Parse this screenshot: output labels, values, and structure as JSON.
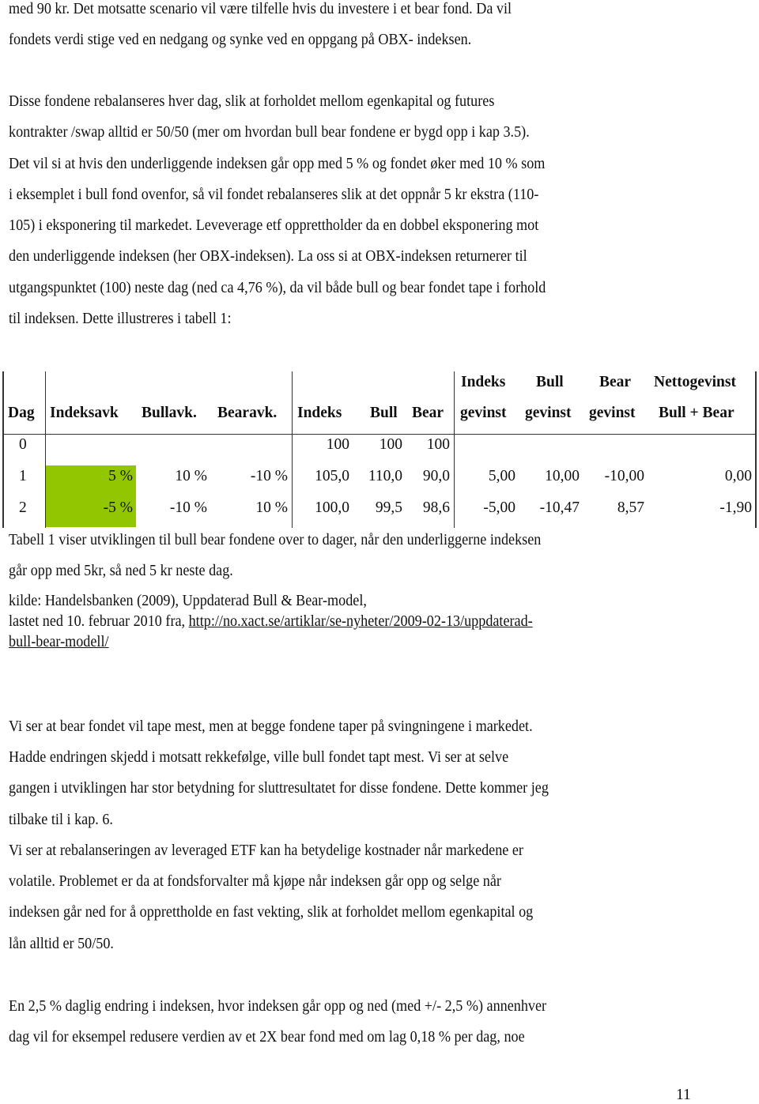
{
  "paragraphs_top": [
    "med 90 kr. Det motsatte scenario vil være tilfelle hvis du investere i et bear fond. Da vil",
    "fondets verdi stige ved en nedgang og synke ved en oppgang på OBX- indeksen.",
    "Disse fondene rebalanseres hver dag, slik at forholdet mellom egenkapital og futures",
    "kontrakter /swap alltid er 50/50 (mer om hvordan bull bear fondene er bygd opp i kap 3.5).",
    "Det vil si at hvis den underliggende indeksen går opp med 5 % og fondet øker med 10 % som",
    "i eksemplet i bull fond ovenfor, så vil fondet rebalanseres slik at det oppnår 5 kr ekstra (110-",
    "105) i eksponering til markedet. Leveverage etf opprettholder da en dobbel eksponering mot",
    "den underliggende indeksen (her OBX-indeksen). La oss si at OBX-indeksen returnerer til",
    "utgangspunktet (100) neste dag (ned ca 4,76 %), da vil både bull og bear fondet tape i forhold",
    "til indeksen. Dette illustreres i tabell 1:"
  ],
  "table": {
    "header_top": [
      "Indeks",
      "Bull",
      "Bear",
      "Nettogevinst"
    ],
    "header": [
      "Dag",
      "Indeksavk",
      "Bullavk.",
      "Bearavk.",
      "Indeks",
      "Bull",
      "Bear",
      "gevinst",
      "gevinst",
      "gevinst",
      "Bull + Bear"
    ],
    "rows": [
      [
        "0",
        "",
        "",
        "",
        "100",
        "100",
        "100",
        "",
        "",
        "",
        ""
      ],
      [
        "1",
        "5 %",
        "10 %",
        "-10 %",
        "105,0",
        "110,0",
        "90,0",
        "5,00",
        "10,00",
        "-10,00",
        "0,00"
      ],
      [
        "2",
        "-5 %",
        "-10 %",
        "10 %",
        "100,0",
        "99,5",
        "98,6",
        "-5,00",
        "-10,47",
        "8,57",
        "-1,90"
      ]
    ],
    "highlight_color": "#92c700"
  },
  "caption": [
    "Tabell 1 viser utviklingen til bull bear fondene over to dager, når den underliggerne indeksen",
    "går opp med 5kr, så ned 5 kr neste dag."
  ],
  "source": {
    "line1": "kilde: Handelsbanken (2009), Uppdaterad Bull & Bear-model,",
    "line2_prefix": "lastet ned 10. februar 2010 fra, ",
    "link_part1": "http://no.xact.se/artiklar/se-nyheter/2009-02-13/uppdaterad-",
    "link_part2": "bull-bear-modell/"
  },
  "paragraphs_bottom": [
    "Vi ser at bear fondet vil tape mest, men at begge fondene taper på svingningene i markedet.",
    "Hadde endringen skjedd i motsatt rekkefølge, ville bull fondet tapt mest. Vi ser at selve",
    "gangen i utviklingen har stor betydning for sluttresultatet for disse fondene. Dette kommer jeg",
    "tilbake til i kap. 6.",
    "Vi ser at rebalanseringen av leveraged ETF kan ha betydelige kostnader når markedene er",
    "volatile. Problemet er da at fondsforvalter må kjøpe når indeksen går opp og selge når",
    "indeksen går ned for å opprettholde en fast vekting, slik at forholdet mellom egenkapital og",
    "lån alltid er 50/50.",
    "En 2,5 % daglig endring i indeksen, hvor indeksen går opp og ned (med +/- 2,5 %) annenhver",
    "dag vil for eksempel redusere verdien av et 2X bear fond med om lag 0,18 % per dag, noe"
  ],
  "page_number": "11"
}
